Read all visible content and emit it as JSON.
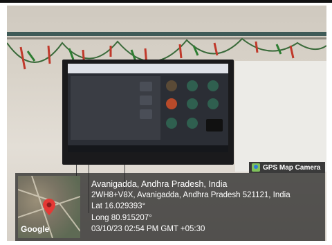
{
  "camera_badge": {
    "label": "GPS Map Camera",
    "icon": "camera-icon"
  },
  "location": {
    "title": "Avanigadda, Andhra Pradesh, India",
    "address": "2WH8+V8X, Avanigadda, Andhra Pradesh 521121, India",
    "lat": "Lat 16.029393°",
    "long": "Long 80.915207°",
    "datetime": "03/10/23 02:54 PM GMT +05:30"
  },
  "map": {
    "provider_label": "Google",
    "pin_color": "#e53935"
  },
  "colors": {
    "overlay": "#1e1e1e",
    "rail": "#3f5a57"
  }
}
